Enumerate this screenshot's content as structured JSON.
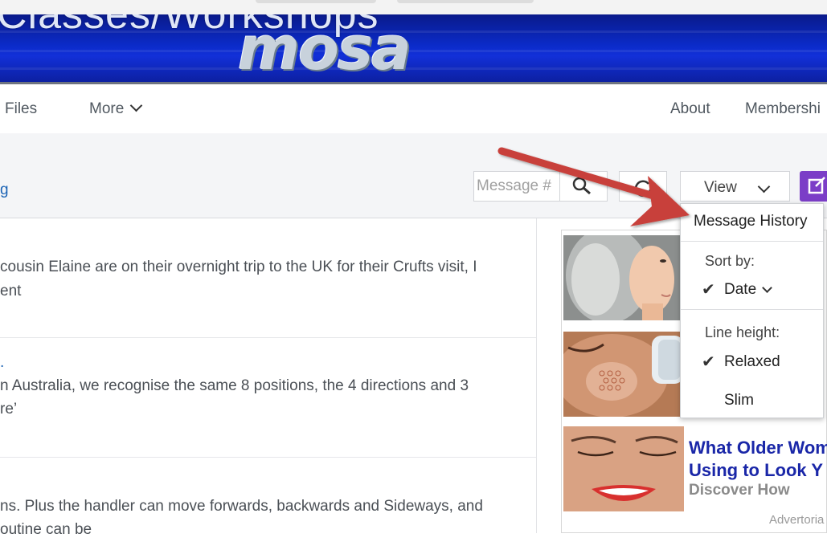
{
  "banner": {
    "title": "Classes/Workshops",
    "logo_text": "mosa"
  },
  "nav": {
    "files": "Files",
    "more": "More",
    "about": "About",
    "membership": "Membershi"
  },
  "toolbar": {
    "left_link": "g",
    "message_placeholder": "Message #",
    "view_label": "View"
  },
  "messages": [
    {
      "dot": "",
      "lines": [
        "cousin Elaine are on their overnight trip to the UK for their Crufts visit, I",
        "ent"
      ]
    },
    {
      "dot": ".",
      "lines": [
        "n Australia, we recognise the same 8 positions, the 4 directions and 3",
        "re’"
      ]
    },
    {
      "dot": "",
      "lines": [
        "ns. Plus the handler can move forwards, backwards and Sideways, and",
        "outine can be"
      ]
    }
  ],
  "ads": {
    "title_line1": "What Older Wom",
    "title_line2": "Using to Look Y",
    "subtitle": "Discover How",
    "note": "Advertoria"
  },
  "dropdown": {
    "message_history": "Message History",
    "sort_by_label": "Sort by:",
    "sort_date": "Date",
    "line_height_label": "Line height:",
    "relaxed": "Relaxed",
    "slim": "Slim"
  },
  "colors": {
    "banner_blue": "#0b2bc9",
    "link_blue": "#1b63b5",
    "ad_title_blue": "#1a27a8",
    "compose_purple": "#7b3ec7",
    "arrow_red": "#c8403a"
  },
  "icons": [
    "search-icon",
    "refresh-icon",
    "chevron-down-icon",
    "compose-icon",
    "checkmark-icon"
  ]
}
